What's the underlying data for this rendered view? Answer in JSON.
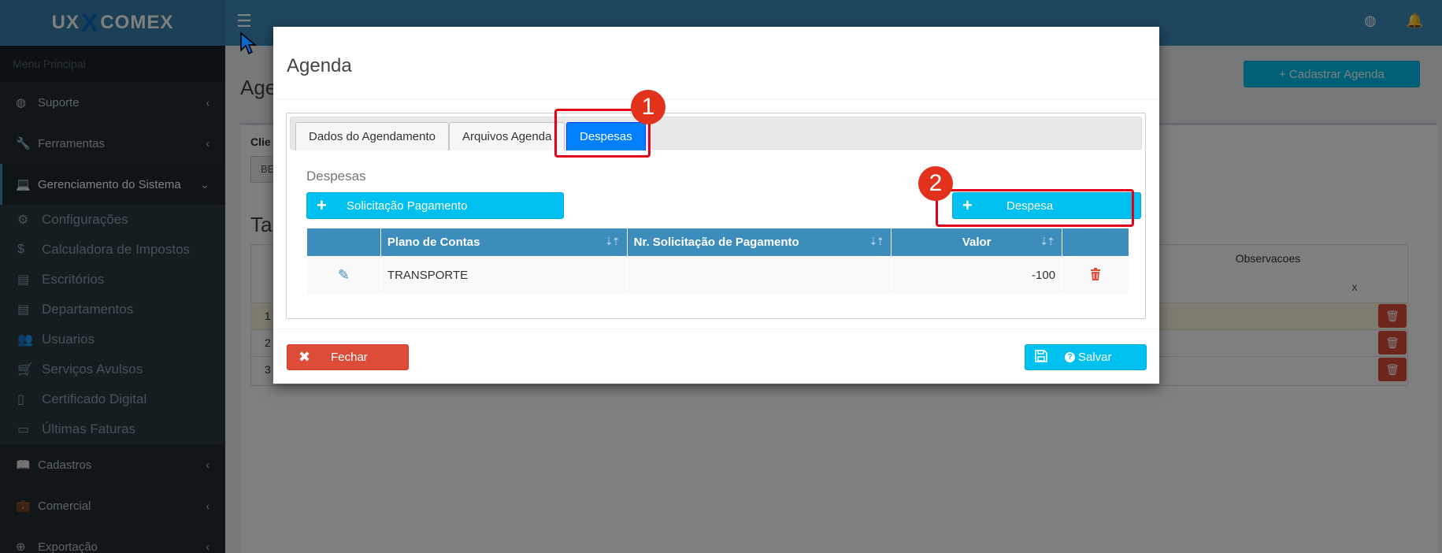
{
  "app": {
    "logo_text_left": "UX",
    "logo_text_x": "X",
    "logo_text_right": "COMEX"
  },
  "sidebar": {
    "header": "Menu Principal",
    "items": [
      {
        "label": "Suporte",
        "icon": "globe-icon"
      },
      {
        "label": "Ferramentas",
        "icon": "wrench-icon"
      },
      {
        "label": "Gerenciamento do Sistema",
        "icon": "laptop-icon"
      }
    ],
    "subitems": [
      {
        "label": "Configurações",
        "icon": "cogs-icon"
      },
      {
        "label": "Calculadora de Impostos",
        "icon": "dollar-icon"
      },
      {
        "label": "Escritórios",
        "icon": "building-icon"
      },
      {
        "label": "Departamentos",
        "icon": "building-icon"
      },
      {
        "label": "Usuarios",
        "icon": "users-icon"
      },
      {
        "label": "Serviços Avulsos",
        "icon": "cart-icon"
      },
      {
        "label": "Certificado Digital",
        "icon": "file-icon"
      },
      {
        "label": "Últimas Faturas",
        "icon": "credit-card-icon"
      }
    ],
    "items_bottom": [
      {
        "label": "Cadastros",
        "icon": "book-icon"
      },
      {
        "label": "Comercial",
        "icon": "briefcase-icon"
      },
      {
        "label": "Exportação",
        "icon": "export-icon"
      }
    ]
  },
  "background": {
    "page_title": "Age",
    "cadastrar_button": "Cadastrar Agenda",
    "cliente_label": "Clie",
    "cliente_value": "BE",
    "section_title": "Tar",
    "observacoes_header": "Observacoes",
    "filter_clear": "x",
    "rows": [
      "1",
      "2",
      "3"
    ]
  },
  "modal": {
    "title": "Agenda",
    "tabs": [
      "Dados do Agendamento",
      "Arquivos Agenda",
      "Despesas"
    ],
    "active_tab": "Despesas",
    "section_title": "Despesas",
    "solicitacao_button": "Solicitação Pagamento",
    "despesa_button": "Despesa",
    "table": {
      "columns": [
        "",
        "Plano de Contas",
        "Nr. Solicitação de Pagamento",
        "Valor",
        ""
      ],
      "rows": [
        {
          "plano": "TRANSPORTE",
          "nr_solicitacao": "",
          "valor": "-100"
        }
      ]
    },
    "fechar_button": "Fechar",
    "salvar_button": "Salvar"
  },
  "annotations": {
    "badge_1": "1",
    "badge_2": "2",
    "color": "#e3001b"
  },
  "colors": {
    "topbar": "#3c8dbc",
    "sidebar": "#222d32",
    "info": "#00c0ef",
    "danger": "#dd4b39",
    "tab_active": "#007fff"
  }
}
